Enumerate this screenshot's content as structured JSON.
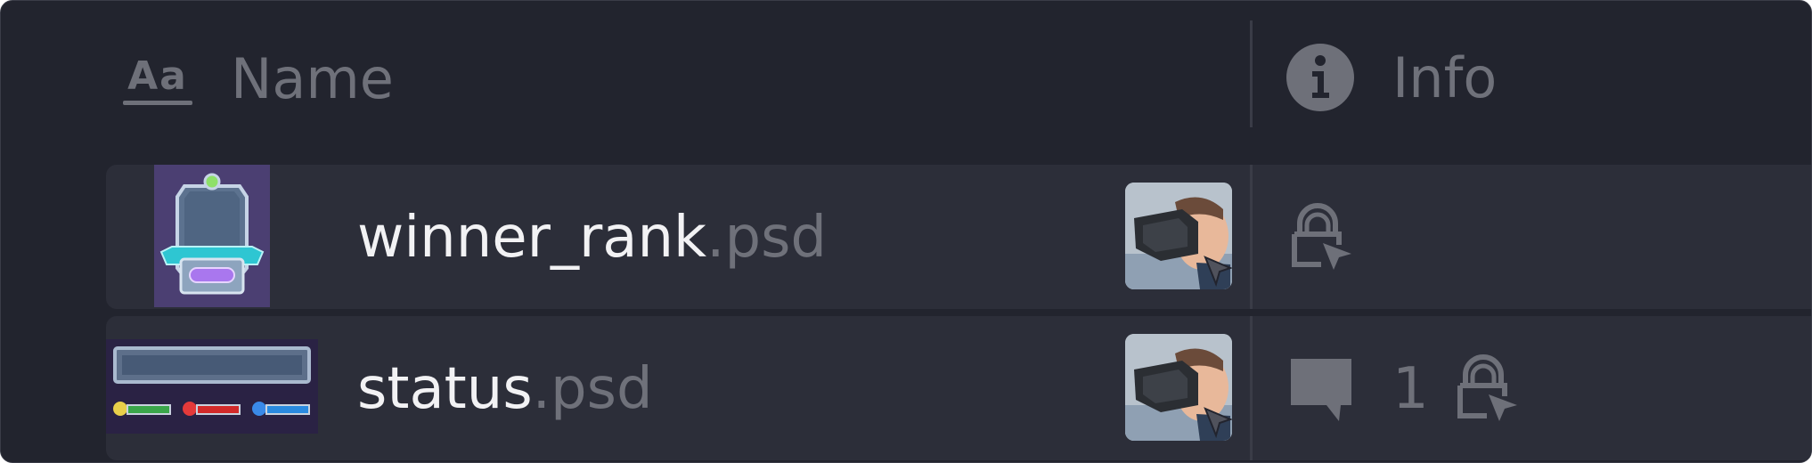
{
  "columns": {
    "name": {
      "label": "Name",
      "icon": "text-format-icon",
      "icon_text": "Aa"
    },
    "info": {
      "label": "Info",
      "icon": "info-icon"
    }
  },
  "files": [
    {
      "base": "winner_rank",
      "ext": ".psd",
      "comments": "",
      "locked": true
    },
    {
      "base": "status",
      "ext": ".psd",
      "comments": "1",
      "locked": true
    }
  ],
  "colors": {
    "background": "#22242e",
    "row": "#2c2e39",
    "text_primary": "#f2f2f4",
    "text_muted": "#6f717a"
  }
}
